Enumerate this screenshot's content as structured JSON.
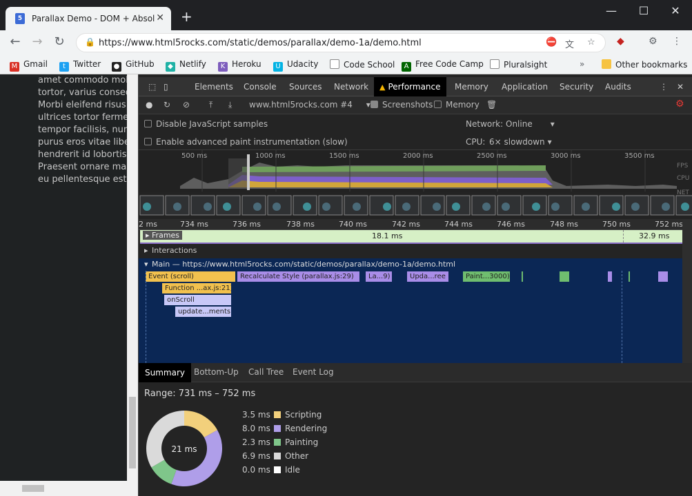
{
  "tab": {
    "title": "Parallax Demo - DOM + Absolute",
    "close": "✕",
    "new_tab": "+"
  },
  "window": {
    "minimize": "—",
    "maximize": "☐",
    "close": "✕"
  },
  "toolbar": {
    "url": "https://www.html5rocks.com/static/demos/parallax/demo-1a/demo.html"
  },
  "bookmarks": [
    {
      "label": "Gmail"
    },
    {
      "label": "Twitter"
    },
    {
      "label": "GitHub"
    },
    {
      "label": "Netlify"
    },
    {
      "label": "Heroku"
    },
    {
      "label": "Udacity"
    },
    {
      "label": "Code School"
    },
    {
      "label": "Free Code Camp"
    },
    {
      "label": "Pluralsight"
    }
  ],
  "other_bookmarks": "Other bookmarks",
  "page_text": [
    "amet commodo mole",
    "tortor, varius conseq",
    "Morbi eleifend risus s",
    "ultrices tortor fermen",
    "tempor facilisis, nunc",
    "purus eros vitae liber",
    "hendrerit id lobortis a",
    "Praesent ornare mas",
    "eu pellentesque est a"
  ],
  "devtools": {
    "tabs": [
      "Elements",
      "Console",
      "Sources",
      "Network",
      "Performance",
      "Memory",
      "Application",
      "Security",
      "Audits"
    ],
    "active_tab": "Performance",
    "profile_select": "www.html5rocks.com #4",
    "screenshots_label": "Screenshots",
    "memory_label": "Memory",
    "disable_js_samples": "Disable JavaScript samples",
    "advanced_paint": "Enable advanced paint instrumentation (slow)",
    "network_label": "Network:",
    "network_value": "Online",
    "cpu_label": "CPU:",
    "cpu_value": "6× slowdown"
  },
  "overview": {
    "ticks": [
      "500 ms",
      "1000 ms",
      "1500 ms",
      "2000 ms",
      "2500 ms",
      "3000 ms",
      "3500 ms"
    ],
    "lanes": [
      "FPS",
      "CPU",
      "NET"
    ]
  },
  "ruler": [
    "2 ms",
    "734 ms",
    "736 ms",
    "738 ms",
    "740 ms",
    "742 ms",
    "744 ms",
    "746 ms",
    "748 ms",
    "750 ms",
    "752 ms"
  ],
  "frames": {
    "label": "Frames",
    "f1": "18.1 ms",
    "f2": "32.9 ms"
  },
  "interactions": "Interactions",
  "main_thread": "Main — https://www.html5rocks.com/static/demos/parallax/demo-1a/demo.html",
  "events": [
    {
      "label": "Event (scroll)",
      "kind": "scripting"
    },
    {
      "label": "Recalculate Style (parallax.js:29)",
      "kind": "rendering"
    },
    {
      "label": "La...9)",
      "kind": "rendering"
    },
    {
      "label": "Upda...ree",
      "kind": "rendering"
    },
    {
      "label": "Paint...3000)",
      "kind": "painting"
    },
    {
      "label": "Function ...ax.js:21)",
      "kind": "scripting"
    },
    {
      "label": "onScroll",
      "kind": "call"
    },
    {
      "label": "update...ments",
      "kind": "call"
    }
  ],
  "summary": {
    "tabs": [
      "Summary",
      "Bottom-Up",
      "Call Tree",
      "Event Log"
    ],
    "range": "Range: 731 ms – 752 ms",
    "total": "21 ms",
    "legend": [
      {
        "value": "3.5 ms",
        "label": "Scripting",
        "color": "#f2d07c",
        "ms": 3.5
      },
      {
        "value": "8.0 ms",
        "label": "Rendering",
        "color": "#af9ee9",
        "ms": 8.0
      },
      {
        "value": "2.3 ms",
        "label": "Painting",
        "color": "#7fc68a",
        "ms": 2.3
      },
      {
        "value": "6.9 ms",
        "label": "Other",
        "color": "#dadada",
        "ms": 6.9
      },
      {
        "value": "0.0 ms",
        "label": "Idle",
        "color": "#ffffff",
        "ms": 0.0
      }
    ]
  },
  "colors": {
    "scripting": "#f2c14e",
    "rendering": "#a98de8",
    "painting": "#6fbd6f",
    "call": "#c8c8f8",
    "frames": "#d6f0c6"
  }
}
